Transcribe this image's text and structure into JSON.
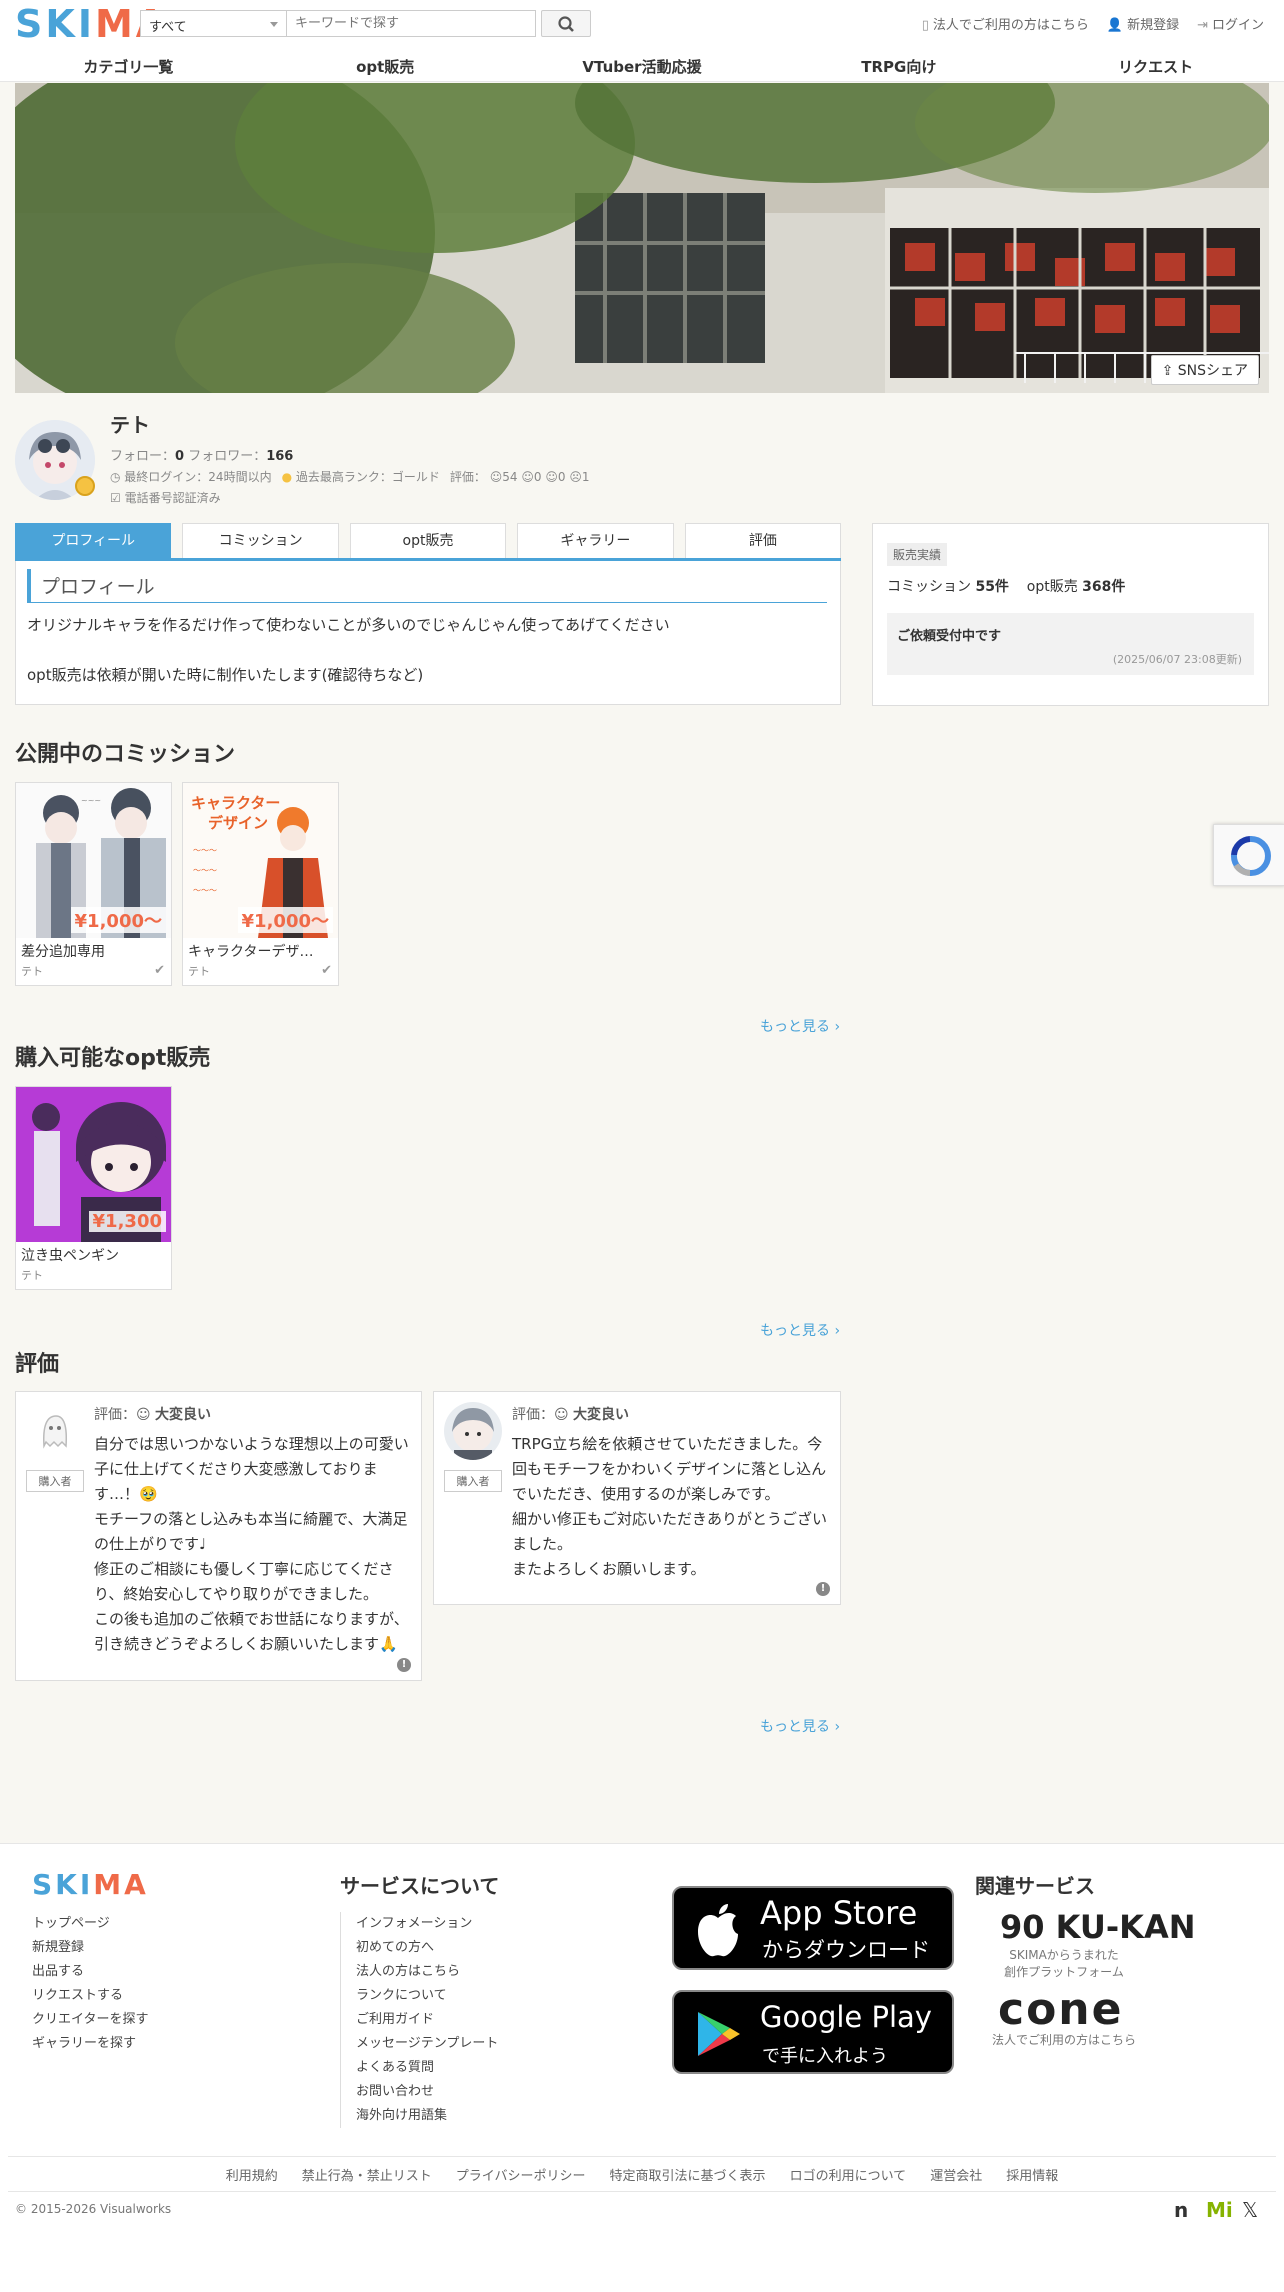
{
  "header": {
    "logo_left": "SKI",
    "logo_right": "MA",
    "category_selected": "すべて",
    "search_placeholder": "キーワードで探す",
    "corporate_link": "法人でご利用の方はこちら",
    "signup_link": "新規登録",
    "login_link": "ログイン"
  },
  "nav": [
    "カテゴリ一覧",
    "opt販売",
    "VTuber活動応援",
    "TRPG向け",
    "リクエスト"
  ],
  "cover": {
    "share_label": "SNSシェア"
  },
  "profile": {
    "name": "テト",
    "follow_label": "フォロー：",
    "follow_count": "0",
    "follower_label": "フォロワー：",
    "follower_count": "166",
    "last_login": "最終ログイン：24時間以内",
    "rank": "過去最高ランク：ゴールド",
    "rating_label": "評価：",
    "ratings": [
      "54",
      "0",
      "0",
      "1"
    ],
    "phone_verified": "電話番号認証済み"
  },
  "tabs": [
    "プロフィール",
    "コミッション",
    "opt販売",
    "ギャラリー",
    "評価"
  ],
  "profile_section": {
    "title": "プロフィール",
    "text": "オリジナルキャラを作るだけ作って使わないことが多いのでじゃんじゃん使ってあげてください\n\nopt販売は依頼が開いた時に制作いたします(確認待ちなど)"
  },
  "sales": {
    "badge": "販売実績",
    "commission_label": "コミッション",
    "commission_count": "55件",
    "opt_label": "opt販売",
    "opt_count": "368件",
    "status": "ご依頼受付中です",
    "updated": "(2025/06/07 23:08更新)"
  },
  "commissions": {
    "title": "公開中のコミッション",
    "items": [
      {
        "title": "差分追加専用",
        "price": "¥1,000〜",
        "creator": "テト"
      },
      {
        "title": "キャラクターデザイン",
        "price": "¥1,000〜",
        "creator": "テト"
      }
    ],
    "more": "もっと見る ›"
  },
  "opt": {
    "title": "購入可能なopt販売",
    "items": [
      {
        "title": "泣き虫ペンギン",
        "price": "¥1,300",
        "creator": "テト"
      }
    ],
    "more": "もっと見る ›"
  },
  "reviews": {
    "title": "評価",
    "items": [
      {
        "rating_label": "評価：",
        "rating": "大変良い",
        "role": "購入者",
        "text": "自分では思いつかないような理想以上の可愛い子に仕上げてくださり大変感激しております…！🥹\nモチーフの落とし込みも本当に綺麗で、大満足の仕上がりです♩\n修正のご相談にも優しく丁寧に応じてくださり、終始安心してやり取りができました。\nこの後も追加のご依頼でお世話になりますが、引き続きどうぞよろしくお願いいたします🙏"
      },
      {
        "rating_label": "評価：",
        "rating": "大変良い",
        "role": "購入者",
        "text": "TRPG立ち絵を依頼させていただきました。今回もモチーフをかわいくデザインに落とし込んでいただき、使用するのが楽しみです。\n細かい修正もご対応いただきありがとうございました。\nまたよろしくお願いします。"
      }
    ],
    "more": "もっと見る ›"
  },
  "footer": {
    "logo_left": "SKI",
    "logo_right": "MA",
    "links_col1": [
      "トップページ",
      "新規登録",
      "出品する",
      "リクエストする",
      "クリエイターを探す",
      "ギャラリーを探す"
    ],
    "service_title": "サービスについて",
    "links_col2": [
      "インフォメーション",
      "初めての方へ",
      "法人の方はこちら",
      "ランクについて",
      "ご利用ガイド",
      "メッセージテンプレート",
      "よくある質問",
      "お問い合わせ",
      "海外向け用語集"
    ],
    "appstore_line1": "App Store",
    "appstore_line2": "からダウンロード",
    "googleplay_line1": "Google Play",
    "googleplay_line2": "で手に入れよう",
    "related_title": "関連サービス",
    "kukan_logo": "90 KU-KAN",
    "kukan_caption_1": "SKIMAからうまれた",
    "kukan_caption_2": "創作プラットフォーム",
    "cone_logo": "cone",
    "cone_caption": "法人でご利用の方はこちら",
    "bottom_links": [
      "利用規約",
      "禁止行為・禁止リスト",
      "プライバシーポリシー",
      "特定商取引法に基づく表示",
      "ロゴの利用について",
      "運営会社",
      "採用情報"
    ],
    "copyright": "© 2015-2026 Visualworks"
  },
  "colors": {
    "accent": "#4aa3d8",
    "price": "#ef6a48",
    "bg": "#f8f7f2"
  }
}
